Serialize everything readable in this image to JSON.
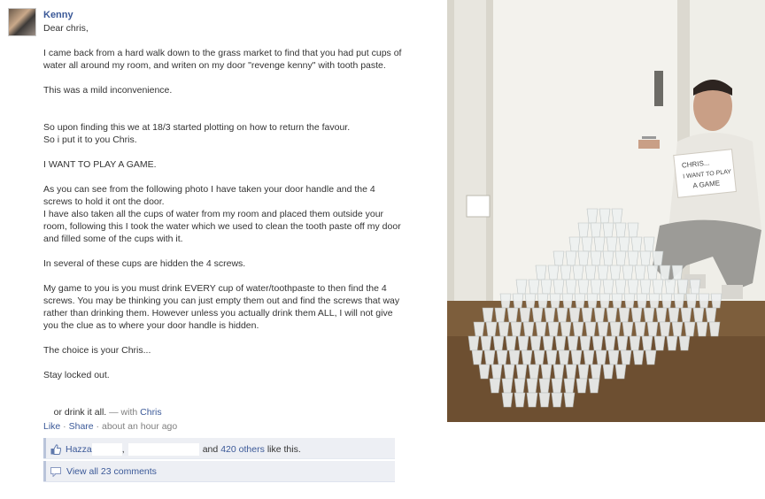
{
  "post": {
    "author": "Kenny",
    "paragraphs": [
      "Dear chris,",
      "I came back from a hard walk down to the grass market to find that you had put cups of water all around my room, and writen on my door \"revenge kenny\" with tooth paste.",
      "This was a mild inconvenience.",
      "\nSo upon finding this we at 18/3 started plotting on how to return the favour.\nSo i put it to you Chris.",
      "I WANT TO PLAY A GAME.",
      "As you can see from the following photo I have taken your door handle and the 4 screws to hold it ont the door.\nI have also taken all the cups of water from my room and placed them outside your room, following this I took the water which we used to clean the tooth paste off my door and filled some of the cups with it.",
      "In several of these cups are hidden the 4 screws.",
      "My game to you is you must drink EVERY cup of water/toothpaste to then find the 4 screws. You may be thinking you can just empty them out and find the screws that way rather than drinking them. However unless you actually drink them ALL, I will not give you the clue as to where your door handle is hidden.",
      "The choice is your Chris...",
      "Stay locked out."
    ],
    "final_line": "or drink it all.",
    "with_prefix": " — with ",
    "with_name": "Chris"
  },
  "actions": {
    "like": "Like",
    "separator1": " · ",
    "share": "Share",
    "separator2": " · ",
    "timestamp": "about an hour ago"
  },
  "likes": {
    "first_name": "Hazza",
    "comma": ",",
    "and_text": "and",
    "others_link": "420 others",
    "suffix": "like this."
  },
  "comments": {
    "view_all": "View all 23 comments"
  },
  "photo": {
    "sign_line1": "CHRIS...",
    "sign_line2": "I WANT TO PLAY",
    "sign_line3": "A GAME"
  },
  "colors": {
    "link": "#3b5998",
    "ufi_background": "#edeff4",
    "muted": "#808080"
  }
}
